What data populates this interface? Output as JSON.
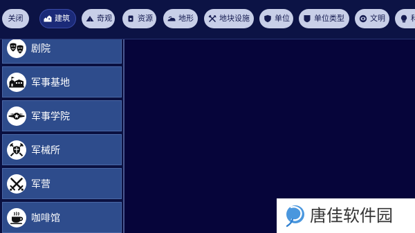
{
  "colors": {
    "topbar_bg": "#0c1345",
    "content_bg": "#06053a",
    "pill_bg": "#c8cfe8",
    "pill_text": "#151b50",
    "pill_selected_bg": "#1b2a78",
    "pill_selected_text": "#ffffff",
    "list_item_bg": "#2e4c8c",
    "list_item_text": "#ffffff",
    "icon_circle": "#ffffff"
  },
  "toolbar": {
    "close_label": "关闭",
    "tabs": [
      {
        "label": "建筑",
        "icon": "buildings-icon",
        "selected": true
      },
      {
        "label": "奇观",
        "icon": "pyramid-icon",
        "selected": false
      },
      {
        "label": "资源",
        "icon": "resource-icon",
        "selected": false
      },
      {
        "label": "地形",
        "icon": "terrain-icon",
        "selected": false
      },
      {
        "label": "地块设施",
        "icon": "hammer-pick-icon",
        "selected": false
      },
      {
        "label": "单位",
        "icon": "shield-icon",
        "selected": false
      },
      {
        "label": "单位类型",
        "icon": "banner-icon",
        "selected": false
      },
      {
        "label": "文明",
        "icon": "civilization-emblem-icon",
        "selected": false
      },
      {
        "label": "科",
        "icon": "technology-icon",
        "selected": false
      }
    ]
  },
  "list": {
    "items": [
      {
        "label": "剧院",
        "icon": "theater-masks-icon"
      },
      {
        "label": "军事基地",
        "icon": "military-base-icon"
      },
      {
        "label": "军事学院",
        "icon": "military-academy-icon"
      },
      {
        "label": "军械所",
        "icon": "armory-icon"
      },
      {
        "label": "军营",
        "icon": "barracks-icon"
      },
      {
        "label": "咖啡馆",
        "icon": "coffee-cup-icon"
      }
    ]
  },
  "watermark": {
    "text": "唐佳软件园",
    "icon": "site-logo-icon"
  }
}
